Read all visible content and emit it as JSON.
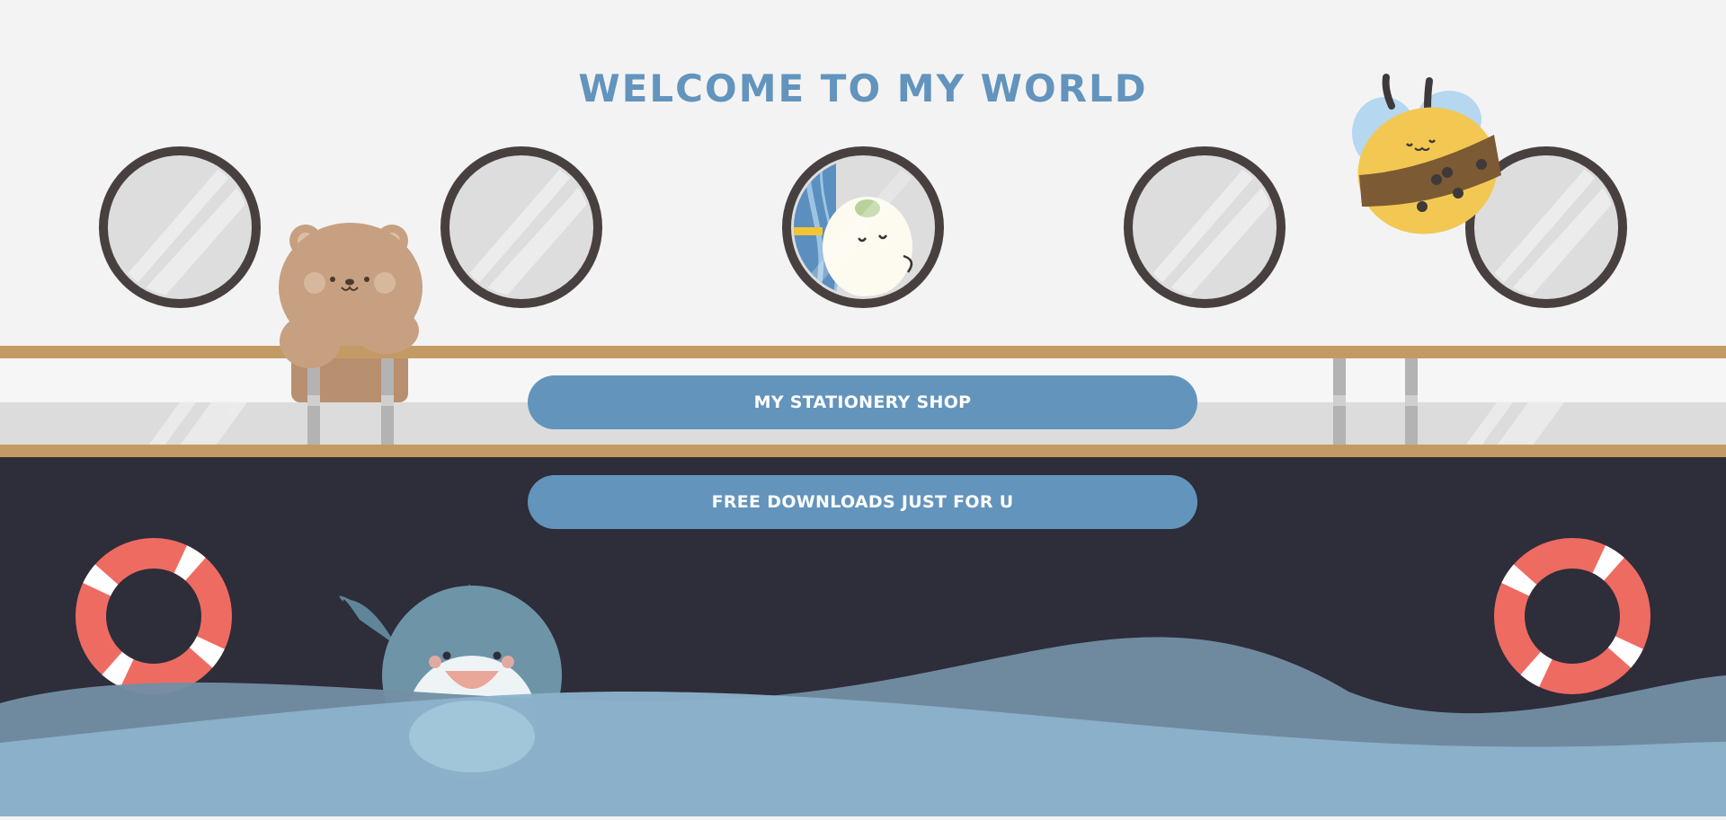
{
  "page": {
    "title": "WELCOME TO MY WORLD"
  },
  "buttons": {
    "shop_label": "MY STATIONERY SHOP",
    "downloads_label": "FREE DOWNLOADS JUST FOR U"
  },
  "colors": {
    "background": "#f3f3f3",
    "accent_blue": "#6294bd",
    "hull": "#2e2d3a",
    "rail": "#c49a64",
    "porthole_frame": "#48403f",
    "porthole_glass": "#dddddd",
    "lifebuoy_red": "#ee6b62",
    "water_light": "#8db2cb",
    "water_dark": "#728fa3"
  },
  "decorations": {
    "portholes": [
      "porthole",
      "porthole",
      "porthole-with-cat",
      "porthole",
      "porthole"
    ],
    "characters": [
      "bear-icon",
      "cat-icon",
      "bee-icon",
      "shark-icon"
    ],
    "lifebuoys": [
      "lifebuoy-icon",
      "lifebuoy-icon"
    ]
  }
}
